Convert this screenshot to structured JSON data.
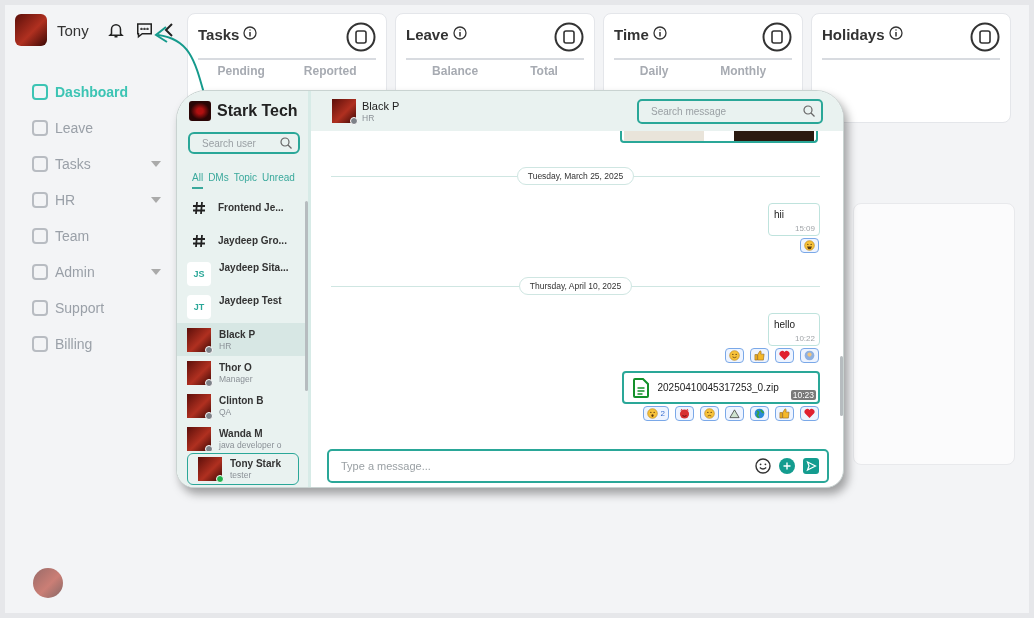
{
  "sidebar": {
    "user": {
      "name": "Tony"
    },
    "items": [
      {
        "label": "Dashboard",
        "selected": true,
        "expandable": false
      },
      {
        "label": "Leave",
        "selected": false,
        "expandable": false
      },
      {
        "label": "Tasks",
        "selected": false,
        "expandable": true
      },
      {
        "label": "HR",
        "selected": false,
        "expandable": true
      },
      {
        "label": "Team",
        "selected": false,
        "expandable": false
      },
      {
        "label": "Admin",
        "selected": false,
        "expandable": true
      },
      {
        "label": "Support",
        "selected": false,
        "expandable": false
      },
      {
        "label": "Billing",
        "selected": false,
        "expandable": false
      }
    ]
  },
  "cards": [
    {
      "title": "Tasks",
      "columns": [
        "Pending",
        "Reported"
      ]
    },
    {
      "title": "Leave",
      "columns": [
        "Balance",
        "Total"
      ]
    },
    {
      "title": "Time",
      "columns": [
        "Daily",
        "Monthly"
      ]
    },
    {
      "title": "Holidays"
    }
  ],
  "chat": {
    "workspace": "Stark Tech",
    "search_user": {
      "placeholder": "Search user"
    },
    "filters": [
      {
        "label": "All",
        "selected": true
      },
      {
        "label": "DMs",
        "selected": false
      },
      {
        "label": "Topic",
        "selected": false
      },
      {
        "label": "Unread",
        "selected": false
      }
    ],
    "contacts": [
      {
        "kind": "channel",
        "name": "Frontend Je...",
        "selected": false
      },
      {
        "kind": "channel",
        "name": "Jaydeep Gro...",
        "selected": false
      },
      {
        "kind": "initials",
        "initials": "JS",
        "name": "Jaydeep Sita...",
        "selected": false
      },
      {
        "kind": "initials",
        "initials": "JT",
        "name": "Jaydeep Test",
        "selected": false
      },
      {
        "kind": "person",
        "name": "Black P",
        "role": "HR",
        "online": false,
        "selected": true
      },
      {
        "kind": "person",
        "name": "Thor O",
        "role": "Manager",
        "online": false,
        "selected": false
      },
      {
        "kind": "person",
        "name": "Clinton B",
        "role": "QA",
        "online": false,
        "selected": false
      },
      {
        "kind": "person",
        "name": "Wanda M",
        "role": "java developer o",
        "online": false,
        "selected": false
      }
    ],
    "me": {
      "name": "Tony Stark",
      "role": "tester",
      "online": true
    },
    "conversation": {
      "name": "Black P",
      "role": "HR",
      "online": false
    },
    "search_message": {
      "placeholder": "Search message"
    },
    "messages": [
      {
        "kind": "media"
      },
      {
        "kind": "date",
        "text": "Tuesday, March 25, 2025"
      },
      {
        "kind": "text",
        "text": "hii",
        "time": "15:09",
        "reactions": [
          {
            "kind": "laugh"
          }
        ]
      },
      {
        "kind": "date",
        "text": "Thursday, April 10, 2025"
      },
      {
        "kind": "text",
        "text": "hello",
        "time": "10:22",
        "reactions": [
          {
            "kind": "smile"
          },
          {
            "kind": "thumbs"
          },
          {
            "kind": "heart"
          },
          {
            "kind": "person"
          }
        ]
      },
      {
        "kind": "file",
        "text": "20250410045317253_0.zip",
        "time": "10:23",
        "reactions": [
          {
            "kind": "scream",
            "count": "2"
          },
          {
            "kind": "devil"
          },
          {
            "kind": "sad"
          },
          {
            "kind": "mountain"
          },
          {
            "kind": "globe"
          },
          {
            "kind": "thumbs"
          },
          {
            "kind": "heart"
          }
        ]
      }
    ],
    "composer": {
      "placeholder": "Type a message..."
    }
  }
}
